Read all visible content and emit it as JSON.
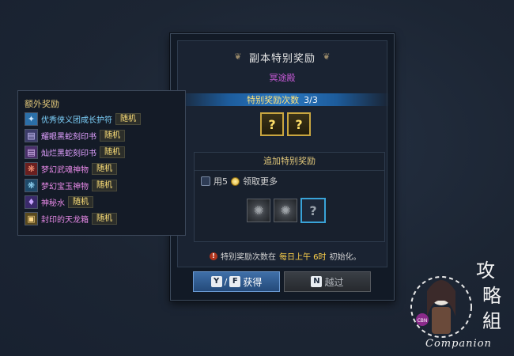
{
  "dialog": {
    "title": "副本特别奖励",
    "dungeon_name": "冥途殿",
    "count_label": "特别奖励次数",
    "count_value": "3/3",
    "reward_slots": [
      "?",
      "?"
    ],
    "extra": {
      "title": "追加特别奖励",
      "use_prefix": "用5",
      "use_suffix": "领取更多",
      "runes": [
        "rune-icon",
        "rune-icon"
      ],
      "unknown_slot": "?"
    },
    "reset_note": {
      "part1": "特别奖励次数在",
      "highlight": "每日上午 6时",
      "part2": "初始化。"
    },
    "buttons": {
      "get": {
        "key1": "Y",
        "sep": "/",
        "key2": "F",
        "label": "获得"
      },
      "skip": {
        "key": "N",
        "label": "越过"
      }
    }
  },
  "side_panel": {
    "title": "额外奖励",
    "items": [
      {
        "name": "优秀侠义团成长护符",
        "tag": "随机",
        "color": "#7fd4ff",
        "icon": "talisman-icon"
      },
      {
        "name": "耀眼黑蛇刻印书",
        "tag": "随机",
        "color": "#e0a0ff",
        "icon": "book-icon"
      },
      {
        "name": "灿烂黑蛇刻印书",
        "tag": "随机",
        "color": "#e0a0ff",
        "icon": "book-icon"
      },
      {
        "name": "梦幻武魂神物",
        "tag": "随机",
        "color": "#e88ae8",
        "icon": "soul-artifact-icon"
      },
      {
        "name": "梦幻宝玉神物",
        "tag": "随机",
        "color": "#e88ae8",
        "icon": "jade-artifact-icon"
      },
      {
        "name": "神秘水",
        "tag": "随机",
        "color": "#e88ae8",
        "icon": "potion-icon"
      },
      {
        "name": "封印的天龙箱",
        "tag": "随机",
        "color": "#e88ae8",
        "icon": "chest-icon"
      }
    ]
  },
  "watermark": {
    "brand": "Companion",
    "seal_text": "攻略組",
    "badge": "CBN"
  }
}
